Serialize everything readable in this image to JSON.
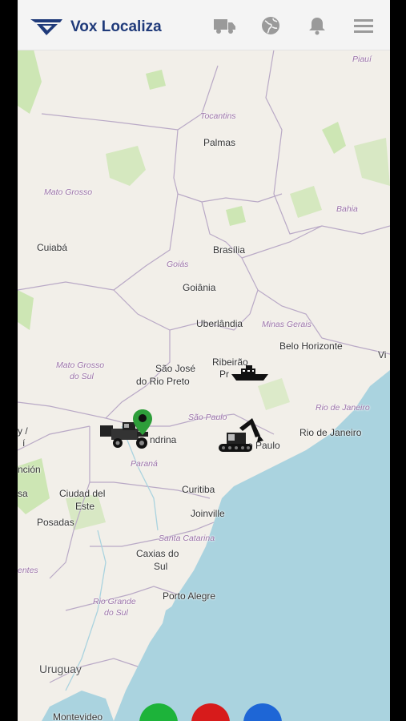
{
  "app": {
    "title": "Vox Localiza"
  },
  "header": {
    "icons": [
      "truck-icon",
      "globe-icon",
      "bell-icon",
      "menu-icon"
    ]
  },
  "map": {
    "cities": {
      "palmas": "Palmas",
      "cuiaba": "Cuiabá",
      "brasilia": "Brasília",
      "goiania": "Goiânia",
      "uberlandia": "Uberlândia",
      "belo_horizonte": "Belo Horizonte",
      "ribeirao": "Ribeirão",
      "ribeirao2": "Pr",
      "sao_jose1": "São José",
      "sao_jose2": "do Rio Preto",
      "londrina": "ndrina",
      "sao_paulo": "o Paulo",
      "rio": "Rio de Janeiro",
      "curitiba": "Curitiba",
      "joinville": "Joinville",
      "ciudad1": "Ciudad del",
      "ciudad2": "Este",
      "posadas": "Posadas",
      "caxias1": "Caxias do",
      "caxias2": "Sul",
      "porto_alegre": "Porto Alegre",
      "vi": "Vi",
      "ncion": "nción",
      "sa": "sa",
      "y": "y /",
      "i": "í",
      "montevideo": "Montevideo"
    },
    "states": {
      "piaui": "Piauí",
      "tocantins": "Tocantins",
      "mato_grosso": "Mato Grosso",
      "bahia": "Bahia",
      "goias": "Goiás",
      "minas": "Minas Gerais",
      "ms1": "Mato Grosso",
      "ms2": "do Sul",
      "sao_paulo": "São Paulo",
      "rio": "Rio de Janeiro",
      "parana": "Paraná",
      "sc": "Santa Catarina",
      "rs1": "Rio Grande",
      "rs2": "do Sul",
      "entes": "entes"
    },
    "countries": {
      "uruguay": "Uruguay"
    },
    "colors": {
      "land": "#f2efe9",
      "water": "#aad3df",
      "forest": "#cde6b4",
      "border": "#b9a9c6"
    }
  },
  "fabs": [
    {
      "name": "green-fab",
      "color": "#1db33a"
    },
    {
      "name": "red-fab",
      "color": "#d71b1b"
    },
    {
      "name": "blue-fab",
      "color": "#1e66d6"
    }
  ]
}
